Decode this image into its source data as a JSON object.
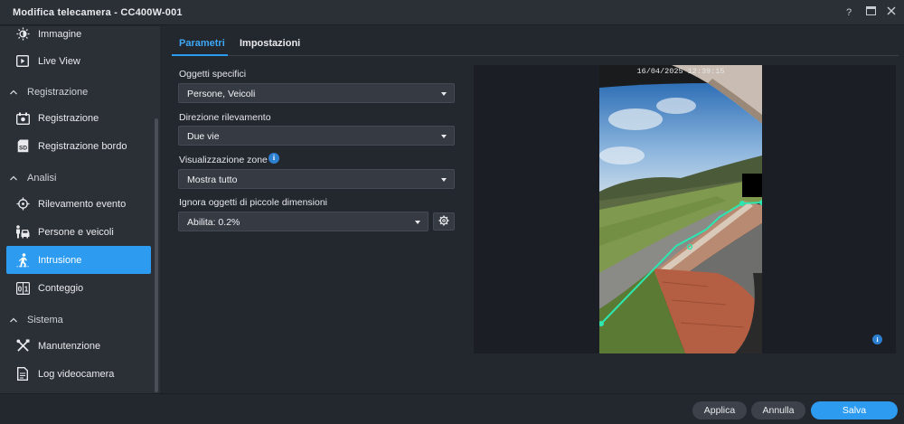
{
  "window": {
    "title": "Modifica telecamera - CC400W-001",
    "help": "?",
    "controls": [
      "help-icon",
      "maximize-icon",
      "close-icon"
    ]
  },
  "sidebar": {
    "items": [
      {
        "label": "Immagine",
        "icon": "brightness-icon"
      },
      {
        "label": "Live View",
        "icon": "play-icon"
      },
      {
        "label": "Registrazione",
        "icon": "recording-icon"
      },
      {
        "label": "Registrazione bordo",
        "icon": "sd-card-icon"
      },
      {
        "label": "Rilevamento evento",
        "icon": "crosshair-icon"
      },
      {
        "label": "Persone e veicoli",
        "icon": "person-car-icon"
      },
      {
        "label": "Intrusione",
        "icon": "walking-person-icon"
      },
      {
        "label": "Conteggio",
        "icon": "counter-icon"
      },
      {
        "label": "Manutenzione",
        "icon": "tools-icon"
      },
      {
        "label": "Log videocamera",
        "icon": "document-icon"
      }
    ],
    "groups": [
      {
        "label": "Registrazione"
      },
      {
        "label": "Analisi"
      },
      {
        "label": "Sistema"
      }
    ],
    "active": "Intrusione"
  },
  "tabs": [
    {
      "label": "Parametri",
      "active": true
    },
    {
      "label": "Impostazioni",
      "active": false
    }
  ],
  "form": {
    "objects": {
      "label": "Oggetti specifici",
      "value": "Persone, Veicoli"
    },
    "direction": {
      "label": "Direzione rilevamento",
      "value": "Due vie"
    },
    "zones": {
      "label": "Visualizzazione zone",
      "value": "Mostra tutto",
      "info": "i"
    },
    "small_objects": {
      "label": "Ignora oggetti di piccole dimensioni",
      "value": "Abilita: 0.2%"
    }
  },
  "preview": {
    "timestamp": "16/04/2025 12:39:15",
    "info": "i"
  },
  "footer": {
    "apply": "Applica",
    "cancel": "Annulla",
    "save": "Salva"
  },
  "colors": {
    "accent": "#2d9cf0",
    "background": "#23272e",
    "panel": "#2b2f36",
    "zone_line": "#2ee6b0"
  }
}
